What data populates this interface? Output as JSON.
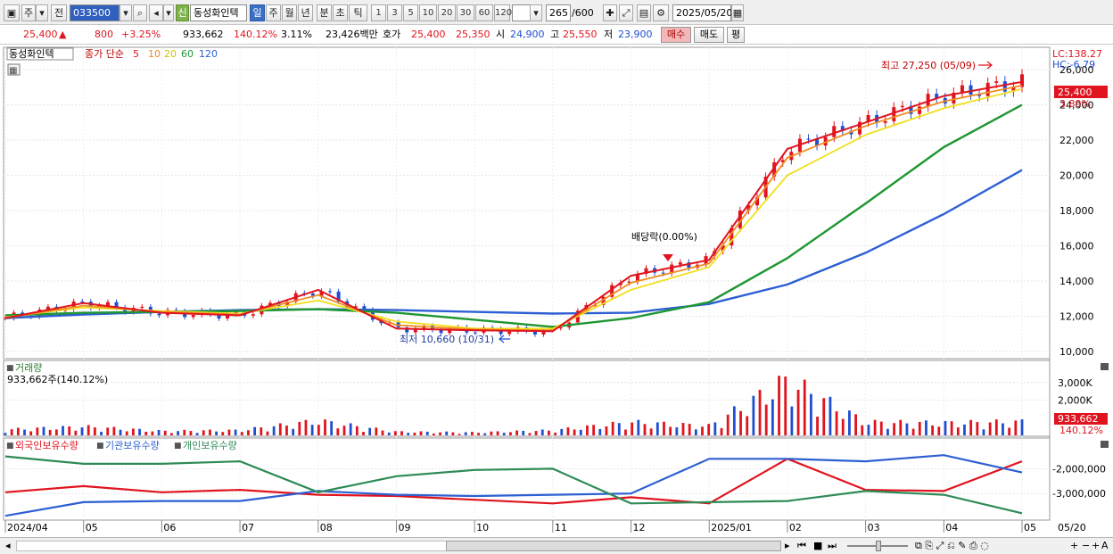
{
  "toolbar": {
    "type_label": "주",
    "prev_label": "전",
    "code": "033500",
    "shin_label": "신",
    "stock_name": "동성화인텍",
    "period_day": "일",
    "period_week": "주",
    "period_month": "월",
    "period_year": "년",
    "period_minute": "분",
    "period_second": "초",
    "period_tick": "틱",
    "n_buttons": [
      "1",
      "3",
      "5",
      "10",
      "20",
      "30",
      "60",
      "120"
    ],
    "count": "265",
    "total": "/600",
    "date": "2025/05/20"
  },
  "quote": {
    "price": "25,400",
    "arrow": "▲",
    "change": "800",
    "change_pct": "+3.25%",
    "volume": "933,662",
    "volume_ratio": "140.12%",
    "turnover": "3.11%",
    "amount": "23,426백만",
    "ask_label": "호가",
    "ask": "25,400",
    "bid": "25,350",
    "open_label": "시",
    "open": "24,900",
    "high_label": "고",
    "high": "25,550",
    "low_label": "저",
    "low": "23,900",
    "buy_label": "매수",
    "sell_label": "매도",
    "eval_label": "평"
  },
  "price_panel": {
    "title": "동성화인텍",
    "legend_label": "종가 단순",
    "ma": [
      {
        "period": "5",
        "color": "#e0141e"
      },
      {
        "period": "10",
        "color": "#f08c1e"
      },
      {
        "period": "20",
        "color": "#f0e01e"
      },
      {
        "period": "60",
        "color": "#1e9632"
      },
      {
        "period": "120",
        "color": "#2d5fd2"
      }
    ],
    "lc": "LC:138.27",
    "hc": "HC:-6.79",
    "high_annot": "최고 27,250 (05/09)",
    "low_annot": "최저 10,660 (10/31)",
    "dividend_annot": "배당락(0.00%)",
    "last_price": "25,400",
    "last_pct": "3.89%"
  },
  "volume_panel": {
    "title": "거래량",
    "info": "933,662주(140.12%)",
    "last": "933,662",
    "last_pct": "140.12%"
  },
  "holders_panel": {
    "series": [
      {
        "name": "외국인보유수량",
        "color": "#e0141e"
      },
      {
        "name": "기관보유수량",
        "color": "#2d5fd2"
      },
      {
        "name": "개인보유수량",
        "color": "#2e8b57"
      }
    ]
  },
  "x_axis": [
    "2024/04",
    "05",
    "06",
    "07",
    "08",
    "09",
    "10",
    "11",
    "12",
    "2025/01",
    "02",
    "03",
    "04",
    "05"
  ],
  "x_axis_last": "05/20",
  "chart_data": [
    {
      "type": "line",
      "title": "",
      "x": [
        "2024/04",
        "05",
        "06",
        "07",
        "08",
        "09",
        "10",
        "11",
        "12",
        "2025/01",
        "02",
        "03",
        "04",
        "05"
      ],
      "ylim": [
        10000,
        26000
      ],
      "y_ticks": [
        10000,
        12000,
        14000,
        16000,
        18000,
        20000,
        22000,
        24000,
        26000
      ],
      "y_tick_labels": [
        "10,000",
        "12,000",
        "14,000",
        "16,000",
        "18,000",
        "20,000",
        "22,000",
        "24,000",
        "26,000"
      ],
      "series": [
        {
          "name": "5",
          "values": [
            11900,
            12750,
            12200,
            12050,
            13500,
            11300,
            11200,
            11150,
            14300,
            15200,
            21500,
            23000,
            24500,
            25300
          ]
        },
        {
          "name": "10",
          "values": [
            11900,
            12600,
            12250,
            12100,
            13200,
            11500,
            11250,
            11200,
            13900,
            15000,
            21000,
            22800,
            24200,
            25100
          ]
        },
        {
          "name": "20",
          "values": [
            11950,
            12500,
            12300,
            12150,
            12900,
            11700,
            11300,
            11300,
            13500,
            14800,
            20000,
            22300,
            23800,
            24900
          ]
        },
        {
          "name": "60",
          "values": [
            12050,
            12200,
            12250,
            12300,
            12400,
            12200,
            11800,
            11400,
            11900,
            12800,
            15300,
            18400,
            21600,
            24000
          ]
        },
        {
          "name": "120",
          "values": [
            11900,
            12100,
            12250,
            12350,
            12400,
            12350,
            12250,
            12150,
            12200,
            12700,
            13800,
            15600,
            17800,
            20300
          ]
        }
      ]
    },
    {
      "type": "bar",
      "title": "",
      "x": [
        "2024/04",
        "05",
        "06",
        "07",
        "08",
        "09",
        "10",
        "11",
        "12",
        "2025/01",
        "02",
        "03",
        "04",
        "05"
      ],
      "ylim": [
        0,
        4000000
      ],
      "y_ticks": [
        2000000,
        3000000
      ],
      "y_tick_labels": [
        "2,000K",
        "3,000K"
      ],
      "values": [
        400000,
        600000,
        300000,
        350000,
        1000000,
        250000,
        200000,
        350000,
        900000,
        650000,
        3800000,
        900000,
        850000,
        933662
      ]
    },
    {
      "type": "line",
      "title": "",
      "x": [
        "2024/04",
        "05",
        "06",
        "07",
        "08",
        "09",
        "10",
        "11",
        "12",
        "2025/01",
        "02",
        "03",
        "04",
        "05"
      ],
      "y_ticks": [
        -2000000,
        -3000000
      ],
      "y_tick_labels": [
        "-2,000,000",
        "-3,000,000"
      ],
      "series": [
        {
          "name": "외국인보유수량",
          "values": [
            -2950000,
            -2700000,
            -2950000,
            -2850000,
            -3050000,
            -3100000,
            -3250000,
            -3400000,
            -3150000,
            -3400000,
            -1600000,
            -2850000,
            -2900000,
            -1700000
          ]
        },
        {
          "name": "기관보유수량",
          "values": [
            -3900000,
            -3350000,
            -3300000,
            -3300000,
            -2900000,
            -3050000,
            -3100000,
            -3050000,
            -3000000,
            -1600000,
            -1600000,
            -1700000,
            -1450000,
            -2150000
          ]
        },
        {
          "name": "개인보유수량",
          "values": [
            -1500000,
            -1800000,
            -1800000,
            -1700000,
            -2950000,
            -2300000,
            -2050000,
            -2000000,
            -3400000,
            -3350000,
            -3300000,
            -2900000,
            -3050000,
            -3800000
          ]
        }
      ]
    }
  ]
}
